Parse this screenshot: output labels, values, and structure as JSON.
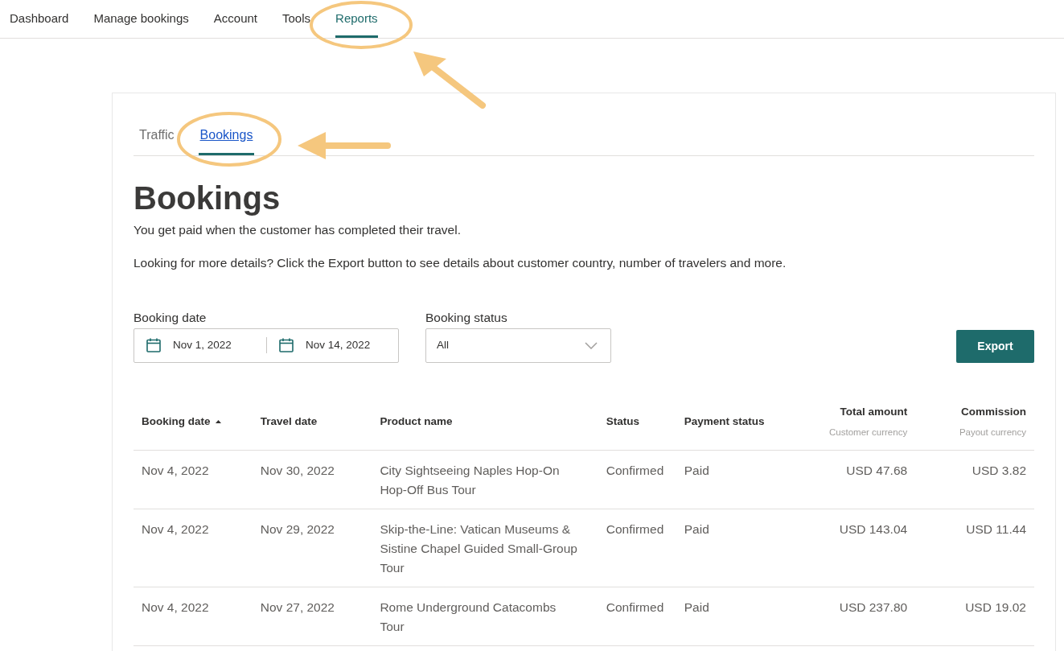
{
  "nav": [
    {
      "label": "Dashboard",
      "selected": false
    },
    {
      "label": "Manage bookings",
      "selected": false
    },
    {
      "label": "Account",
      "selected": false
    },
    {
      "label": "Tools",
      "selected": false
    },
    {
      "label": "Reports",
      "selected": true
    }
  ],
  "tabs": [
    {
      "label": "Traffic",
      "selected": false
    },
    {
      "label": "Bookings",
      "selected": true
    }
  ],
  "heading": "Bookings",
  "paragraphs": [
    "You get paid when the customer has completed their travel.",
    "Looking for more details? Click the Export button to see details about customer country, number of travelers and more."
  ],
  "filters": {
    "booking_date": {
      "label": "Booking date",
      "from": "Nov 1, 2022",
      "to": "Nov 14, 2022"
    },
    "booking_status": {
      "label": "Booking status",
      "value": "All"
    },
    "export_button": "Export"
  },
  "table": {
    "columns": [
      {
        "label": "Booking date",
        "sorted": true,
        "kind": "text"
      },
      {
        "label": "Travel date",
        "sorted": false,
        "kind": "text"
      },
      {
        "label": "Product name",
        "sorted": false,
        "kind": "text"
      },
      {
        "label": "Status",
        "sorted": false,
        "kind": "text"
      },
      {
        "label": "Payment status",
        "sorted": false,
        "kind": "text"
      },
      {
        "label": "Total amount",
        "sublabel": "Customer currency",
        "sorted": false,
        "kind": "amount"
      },
      {
        "label": "Commission",
        "sublabel": "Payout currency",
        "sorted": false,
        "kind": "amount"
      }
    ],
    "rows": [
      [
        "Nov 4, 2022",
        "Nov 30, 2022",
        "City Sightseeing Naples Hop-On Hop-Off Bus Tour",
        "Confirmed",
        "Paid",
        "USD 47.68",
        "USD 3.82"
      ],
      [
        "Nov 4, 2022",
        "Nov 29, 2022",
        "Skip-the-Line: Vatican Museums & Sistine Chapel Guided Small-Group Tour",
        "Confirmed",
        "Paid",
        "USD 143.04",
        "USD 11.44"
      ],
      [
        "Nov 4, 2022",
        "Nov 27, 2022",
        "Rome Underground Catacombs Tour",
        "Confirmed",
        "Paid",
        "USD 237.80",
        "USD 19.02"
      ]
    ]
  }
}
